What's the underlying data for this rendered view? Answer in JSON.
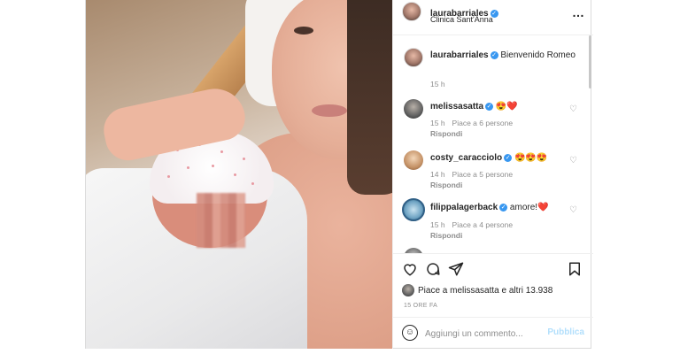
{
  "post": {
    "username": "laurabarriales",
    "location": "Clinica Sant'Anna",
    "more_icon": "…"
  },
  "caption": {
    "username": "laurabarriales",
    "text": "Bienvenido Romeo",
    "time": "15 h"
  },
  "comments": [
    {
      "username": "melissasatta",
      "verified": true,
      "text": "😍❤️",
      "time": "15 h",
      "likes": "Piace a 6 persone",
      "reply": "Rispondi"
    },
    {
      "username": "costy_caracciolo",
      "verified": true,
      "text": "😍😍😍",
      "time": "14 h",
      "likes": "Piace a 5 persone",
      "reply": "Rispondi"
    },
    {
      "username": "filippalagerback",
      "verified": true,
      "text": "amore!❤️",
      "time": "15 h",
      "likes": "Piace a 4 persone",
      "reply": "Rispondi"
    }
  ],
  "actions": {
    "liked_by": "Piace a melissasatta e altri 13.938",
    "date": "15 ORE FA"
  },
  "add_comment": {
    "placeholder": "Aggiungi un commento...",
    "publish": "Pubblica"
  },
  "colors": {
    "verified": "#3897f0",
    "publish": "#b2dffc",
    "muted": "#8e8e8e"
  }
}
